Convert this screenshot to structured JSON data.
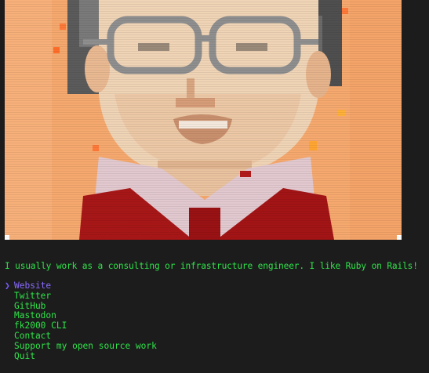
{
  "bio": "I usually work as a consulting or infrastructure engineer. I like Ruby on Rails!",
  "menu": {
    "cursor": "❯",
    "items": [
      {
        "label": "Website",
        "selected": true
      },
      {
        "label": "Twitter",
        "selected": false
      },
      {
        "label": "GitHub",
        "selected": false
      },
      {
        "label": "Mastodon",
        "selected": false
      },
      {
        "label": "fk2000 CLI",
        "selected": false
      },
      {
        "label": "Contact",
        "selected": false
      },
      {
        "label": "Support my open source work",
        "selected": false
      },
      {
        "label": "Quit",
        "selected": false
      }
    ]
  },
  "colors": {
    "background": "#1c1c1c",
    "text": "#2fe34a",
    "selected": "#8a6bff",
    "portrait_bg": "#f6a96e"
  },
  "portrait": {
    "icon": "pixel-art-portrait"
  }
}
